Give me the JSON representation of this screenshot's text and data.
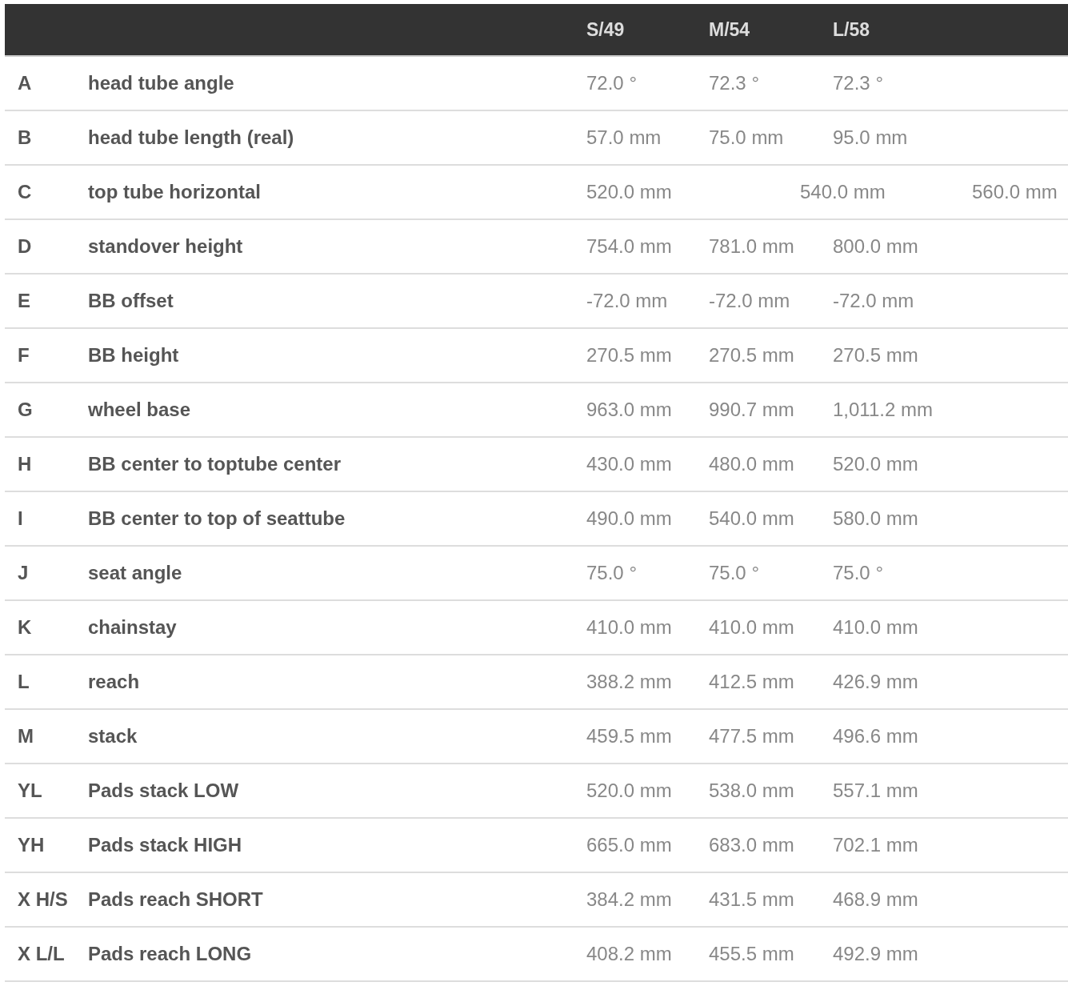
{
  "table": {
    "columns": [
      "S/49",
      "M/54",
      "L/58"
    ],
    "rows": [
      {
        "code": "A",
        "name": "head tube angle",
        "kind": "regular",
        "values": [
          "72.0 °",
          "72.3 °",
          "72.3 °"
        ]
      },
      {
        "code": "B",
        "name": "head tube length (real)",
        "kind": "regular",
        "values": [
          "57.0 mm",
          "75.0 mm",
          "95.0 mm"
        ]
      },
      {
        "code": "C",
        "name": "top tube horizontal",
        "kind": "shifted",
        "values": [
          "520.0 mm",
          "540.0 mm",
          "560.0 mm"
        ]
      },
      {
        "code": "D",
        "name": "standover height",
        "kind": "regular",
        "values": [
          "754.0 mm",
          "781.0 mm",
          "800.0 mm"
        ]
      },
      {
        "code": "E",
        "name": "BB offset",
        "kind": "regular",
        "values": [
          "-72.0 mm",
          "-72.0 mm",
          "-72.0 mm"
        ]
      },
      {
        "code": "F",
        "name": "BB height",
        "kind": "regular",
        "values": [
          "270.5 mm",
          "270.5 mm",
          "270.5 mm"
        ]
      },
      {
        "code": "G",
        "name": "wheel base",
        "kind": "regular",
        "values": [
          "963.0 mm",
          "990.7 mm",
          "1,011.2 mm"
        ]
      },
      {
        "code": "H",
        "name": "BB center to toptube center",
        "kind": "regular",
        "values": [
          "430.0 mm",
          "480.0 mm",
          "520.0 mm"
        ]
      },
      {
        "code": "I",
        "name": "BB center to top of seattube",
        "kind": "regular",
        "values": [
          "490.0 mm",
          "540.0 mm",
          "580.0 mm"
        ]
      },
      {
        "code": "J",
        "name": "seat angle",
        "kind": "regular",
        "values": [
          "75.0 °",
          "75.0 °",
          "75.0 °"
        ]
      },
      {
        "code": "K",
        "name": "chainstay",
        "kind": "regular",
        "values": [
          "410.0 mm",
          "410.0 mm",
          "410.0 mm"
        ]
      },
      {
        "code": "L",
        "name": "reach",
        "kind": "regular",
        "values": [
          "388.2 mm",
          "412.5 mm",
          "426.9 mm"
        ]
      },
      {
        "code": "M",
        "name": "stack",
        "kind": "regular",
        "values": [
          "459.5 mm",
          "477.5 mm",
          "496.6 mm"
        ]
      },
      {
        "code": "YL",
        "name": "Pads stack LOW",
        "kind": "regular",
        "values": [
          "520.0 mm",
          "538.0 mm",
          "557.1 mm"
        ]
      },
      {
        "code": "YH",
        "name": "Pads stack HIGH",
        "kind": "regular",
        "values": [
          "665.0 mm",
          "683.0 mm",
          "702.1 mm"
        ]
      },
      {
        "code": "X H/S",
        "name": "Pads reach SHORT",
        "kind": "regular",
        "values": [
          "384.2 mm",
          "431.5 mm",
          "468.9 mm"
        ]
      },
      {
        "code": "X L/L",
        "name": "Pads reach LONG",
        "kind": "regular",
        "values": [
          "408.2 mm",
          "455.5 mm",
          "492.9 mm"
        ]
      }
    ]
  }
}
